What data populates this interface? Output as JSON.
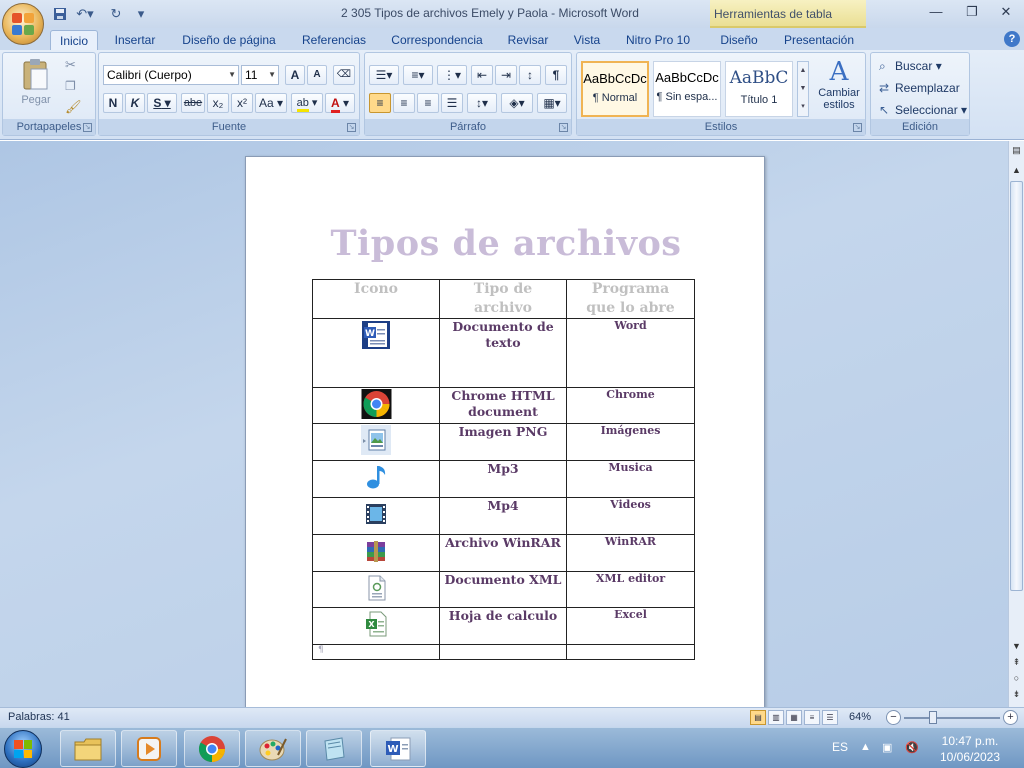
{
  "window": {
    "title": "2 305 Tipos de archivos Emely y Paola - Microsoft Word",
    "contextual_tab_group": "Herramientas de tabla"
  },
  "ribbon_tabs": [
    "Inicio",
    "Insertar",
    "Diseño de página",
    "Referencias",
    "Correspondencia",
    "Revisar",
    "Vista",
    "Nitro Pro 10",
    "Diseño",
    "Presentación"
  ],
  "active_tab": "Inicio",
  "clipboard": {
    "paste_label": "Pegar",
    "group_label": "Portapapeles"
  },
  "font": {
    "group_label": "Fuente",
    "font_name": "Calibri (Cuerpo)",
    "font_size": "11",
    "grow_label": "A",
    "shrink_label": "A",
    "bold_label": "N",
    "italic_label": "K",
    "underline_label": "S",
    "strike_label": "abe",
    "subscript_label": "x₂",
    "superscript_label": "x²",
    "case_label": "Aa",
    "highlight_label": "ab",
    "font_color_label": "A"
  },
  "paragraph": {
    "group_label": "Párrafo",
    "show_marks_label": "¶"
  },
  "styles": {
    "group_label": "Estilos",
    "items": [
      {
        "sample": "AaBbCcDc",
        "name": "¶ Normal"
      },
      {
        "sample": "AaBbCcDc",
        "name": "¶ Sin espa..."
      },
      {
        "sample": "AaBbC",
        "name": "Título 1"
      }
    ],
    "change_styles": [
      "Cambiar",
      "estilos"
    ]
  },
  "editing": {
    "group_label": "Edición",
    "find": "Buscar",
    "replace": "Reemplazar",
    "select": "Seleccionar"
  },
  "document": {
    "title": "Tipos de archivos",
    "headers": [
      {
        "line1": "Icono",
        "line2": ""
      },
      {
        "line1": "Tipo de",
        "line2": "archivo"
      },
      {
        "line1": "Programa",
        "line2": "que lo abre"
      }
    ],
    "rows": [
      {
        "icon": "word-doc-icon",
        "type": "Documento de texto",
        "program": "Word"
      },
      {
        "icon": "chrome-icon",
        "type": "Chrome HTML document",
        "program": "Chrome"
      },
      {
        "icon": "image-png-icon",
        "type": "Imagen PNG",
        "program": "Imágenes"
      },
      {
        "icon": "music-note-icon",
        "type": "Mp3",
        "program": "Musica"
      },
      {
        "icon": "film-icon",
        "type": "Mp4",
        "program": "Videos"
      },
      {
        "icon": "winrar-icon",
        "type": "Archivo WinRAR",
        "program": "WinRAR"
      },
      {
        "icon": "xml-file-icon",
        "type": "Documento XML",
        "program": "XML editor"
      },
      {
        "icon": "excel-sheet-icon",
        "type": "Hoja de calculo",
        "program": "Excel"
      },
      {
        "icon": "",
        "type": "",
        "program": ""
      }
    ],
    "last_row_mark": "¶"
  },
  "statusbar": {
    "words": "Palabras: 41",
    "zoom": "64%"
  },
  "taskbar": {
    "language": "ES",
    "time": "10:47 p.m.",
    "date": "10/06/2023"
  }
}
